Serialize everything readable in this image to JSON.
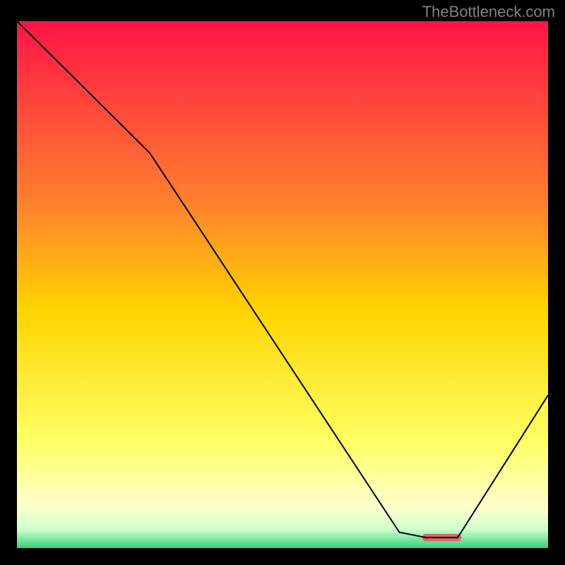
{
  "watermark": "TheBottleneck.com",
  "chart_data": {
    "type": "line",
    "title": "",
    "xlabel": "",
    "ylabel": "",
    "xlim": [
      0,
      100
    ],
    "ylim": [
      0,
      100
    ],
    "grid": false,
    "line": {
      "name": "curve",
      "color": "#000000",
      "x": [
        0,
        25,
        72,
        77,
        83,
        100
      ],
      "y": [
        100,
        75,
        3,
        2,
        2,
        29
      ],
      "notes": "V-shaped black curve: steep fall from top-left (100) with slight slope break near x≈25, reaching a flat minimum ≈2 around x≈77–83, then rising to ≈29 at right edge."
    },
    "trough_marker": {
      "color": "#d66868",
      "x_start": 77,
      "x_end": 83,
      "y": 2,
      "thickness_pct": 1.4
    },
    "background_gradient": {
      "stops": [
        {
          "pos": 0.0,
          "color": "#ff1447"
        },
        {
          "pos": 0.34,
          "color": "#ff7f2e"
        },
        {
          "pos": 0.55,
          "color": "#ffd400"
        },
        {
          "pos": 0.8,
          "color": "#ffff66"
        },
        {
          "pos": 0.92,
          "color": "#ffffcc"
        },
        {
          "pos": 0.965,
          "color": "#ccffcc"
        },
        {
          "pos": 1.0,
          "color": "#33d17a"
        }
      ]
    }
  }
}
